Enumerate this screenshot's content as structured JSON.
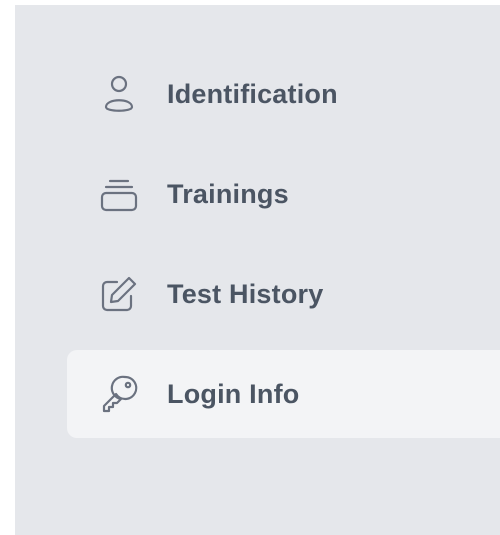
{
  "sidebar": {
    "items": [
      {
        "label": "Identification",
        "icon": "user-icon",
        "active": false
      },
      {
        "label": "Trainings",
        "icon": "archive-icon",
        "active": false
      },
      {
        "label": "Test History",
        "icon": "edit-icon",
        "active": false
      },
      {
        "label": "Login Info",
        "icon": "key-icon",
        "active": true
      }
    ]
  },
  "colors": {
    "sidebar_bg": "#e5e7eb",
    "active_bg": "#f3f4f6",
    "text": "#4b5563",
    "icon": "#6b7280"
  }
}
